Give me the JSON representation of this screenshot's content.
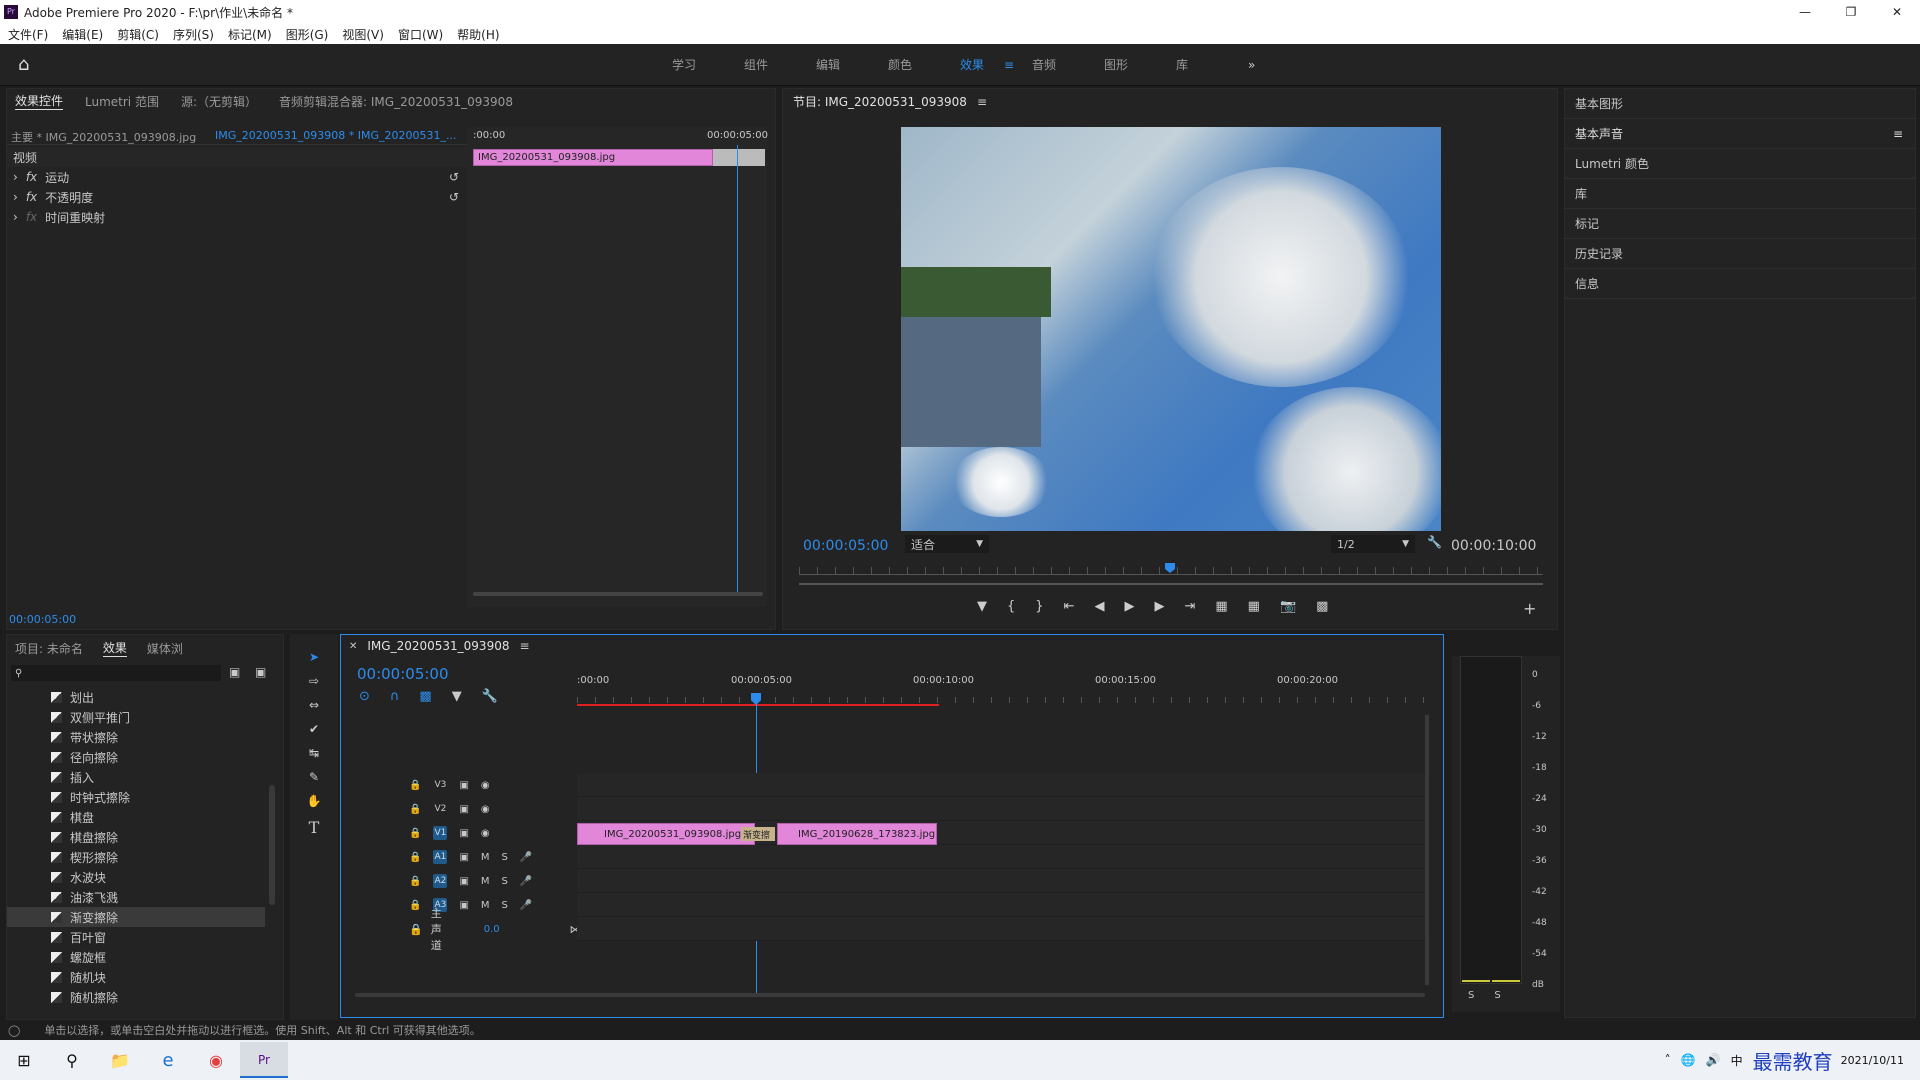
{
  "app": {
    "title": "Adobe Premiere Pro 2020 - F:\\pr\\作业\\未命名 *",
    "icon": "Pr"
  },
  "menu": [
    "文件(F)",
    "编辑(E)",
    "剪辑(C)",
    "序列(S)",
    "标记(M)",
    "图形(G)",
    "视图(V)",
    "窗口(W)",
    "帮助(H)"
  ],
  "workspaces": [
    "学习",
    "组件",
    "编辑",
    "颜色",
    "效果",
    "音频",
    "图形",
    "库"
  ],
  "workspace_active": "效果",
  "effect_controls": {
    "tabs": [
      "效果控件",
      "Lumetri 范围",
      "源:（无剪辑）",
      "音频剪辑混合器: IMG_20200531_093908"
    ],
    "master": "主要 * IMG_20200531_093908.jpg",
    "sequence": "IMG_20200531_093908 * IMG_20200531_...",
    "section": "视频",
    "props": [
      "运动",
      "不透明度",
      "时间重映射"
    ],
    "time_start": ":00:00",
    "time_end": "00:00:05:00",
    "clip": "IMG_20200531_093908.jpg",
    "timecode": "00:00:05:00"
  },
  "program": {
    "title": "节目: IMG_20200531_093908",
    "timecode": "00:00:05:00",
    "fit": "适合",
    "resolution": "1/2",
    "duration": "00:00:10:00"
  },
  "right_panels": [
    "基本图形",
    "基本声音",
    "Lumetri 颜色",
    "库",
    "标记",
    "历史记录",
    "信息"
  ],
  "project": {
    "tabs": [
      "项目: 未命名",
      "效果",
      "媒体浏"
    ],
    "effects": [
      "划出",
      "双侧平推门",
      "带状擦除",
      "径向擦除",
      "插入",
      "时钟式擦除",
      "棋盘",
      "棋盘擦除",
      "楔形擦除",
      "水波块",
      "油漆飞溅",
      "渐变擦除",
      "百叶窗",
      "螺旋框",
      "随机块",
      "随机擦除"
    ],
    "selected": "渐变擦除"
  },
  "timeline": {
    "title": "IMG_20200531_093908",
    "timecode": "00:00:05:00",
    "ruler": [
      ":00:00",
      "00:00:05:00",
      "00:00:10:00",
      "00:00:15:00",
      "00:00:20:00"
    ],
    "video_tracks": [
      "V3",
      "V2",
      "V1"
    ],
    "audio_tracks": [
      "A1",
      "A2",
      "A3"
    ],
    "master": "主声道",
    "master_val": "0.0",
    "clip1": "IMG_20200531_093908.jpg",
    "transition": "渐变擦",
    "clip2": "IMG_20190628_173823.jpg"
  },
  "meter": {
    "scale": [
      "0",
      "-6",
      "-12",
      "-18",
      "-24",
      "-30",
      "-36",
      "-42",
      "-48",
      "-54",
      "dB"
    ],
    "solo": [
      "S",
      "S"
    ]
  },
  "status": "单击以选择，或单击空白处并拖动以进行框选。使用 Shift、Alt 和 Ctrl 可获得其他选项。",
  "tray": {
    "ime": "中",
    "date": "2021/10/11",
    "watermark": "最需教育"
  }
}
